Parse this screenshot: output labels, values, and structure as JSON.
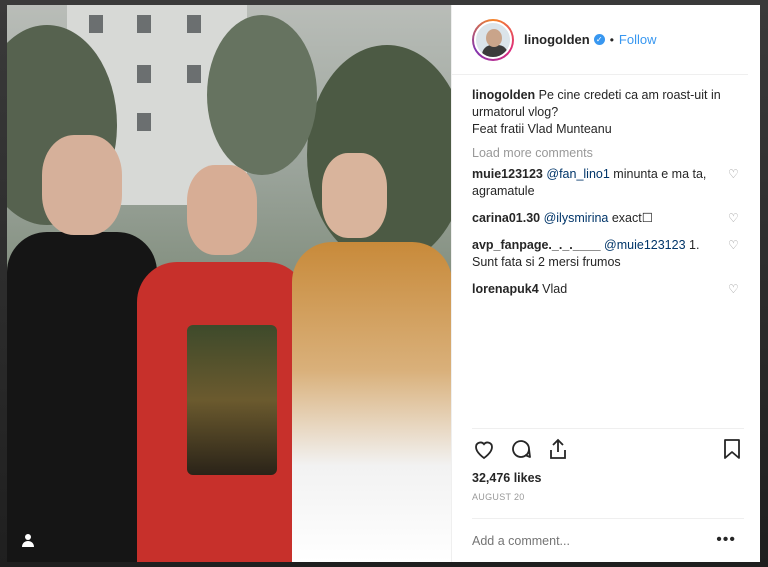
{
  "post": {
    "username": "linogolden",
    "verified_glyph": "✓",
    "follow_label": "Follow",
    "separator": "•",
    "caption_user": "linogolden",
    "caption_text": "Pe cine credeti ca am roast-uit in urmatorul vlog?\nFeat fratii Vlad Munteanu",
    "load_more": "Load more comments",
    "comments": [
      {
        "user": "muie123123",
        "mention": "@fan_lino1",
        "text": "minunta e ma ta, agramatule"
      },
      {
        "user": "carina01.30",
        "mention": "@ilysmirina",
        "text": "exact☐"
      },
      {
        "user": "avp_fanpage._._.____",
        "mention": "@muie123123",
        "text": "1. Sunt fata si 2 mersi frumos"
      },
      {
        "user": "lorenapuk4",
        "mention": "",
        "text": "Vlad"
      }
    ],
    "likes": "32,476 likes",
    "date": "AUGUST 20",
    "add_comment_placeholder": "Add a comment...",
    "more_glyph": "•••"
  },
  "icons": {
    "heart": "heart-icon",
    "comment": "comment-icon",
    "share": "share-icon",
    "bookmark": "bookmark-icon",
    "user_tag": "user-tag-icon"
  },
  "colors": {
    "accent": "#3897f0",
    "text": "#262626",
    "muted": "#999999",
    "mention": "#003569"
  }
}
